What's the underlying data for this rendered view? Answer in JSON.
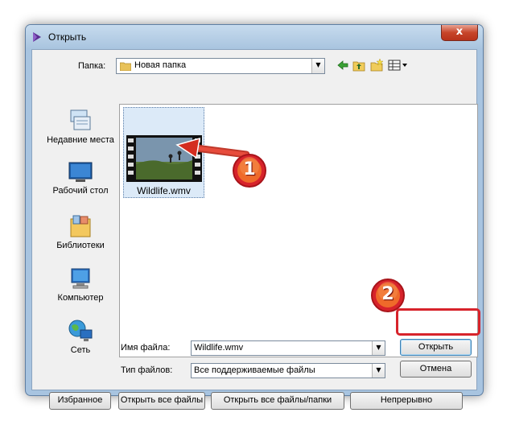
{
  "window": {
    "title": "Открыть",
    "close_glyph": "x"
  },
  "toolbar": {
    "folder_label": "Папка:",
    "folder_value": "Новая папка",
    "icons": [
      "back-arrow-icon",
      "up-folder-icon",
      "new-folder-icon",
      "view-menu-icon"
    ]
  },
  "places": [
    {
      "label": "Недавние места",
      "icon": "recent-places-icon"
    },
    {
      "label": "Рабочий стол",
      "icon": "desktop-icon"
    },
    {
      "label": "Библиотеки",
      "icon": "libraries-icon"
    },
    {
      "label": "Компьютер",
      "icon": "computer-icon"
    },
    {
      "label": "Сеть",
      "icon": "network-icon"
    }
  ],
  "files": [
    {
      "name": "Wildlife.wmv",
      "icon": "video-thumbnail-icon",
      "selected": true
    }
  ],
  "form": {
    "filename_label": "Имя файла:",
    "filename_value": "Wildlife.wmv",
    "filetype_label": "Тип файлов:",
    "filetype_value": "Все поддерживаемые файлы"
  },
  "buttons": {
    "open": "Открыть",
    "cancel": "Отмена",
    "favorites": "Избранное",
    "open_all_files": "Открыть все файлы",
    "open_all_files_folders": "Открыть все файлы/папки",
    "continuous": "Непрерывно"
  },
  "annotations": {
    "step1": "1",
    "step2": "2",
    "highlight_color": "#d7232b",
    "badge_color": "#e8581c"
  }
}
